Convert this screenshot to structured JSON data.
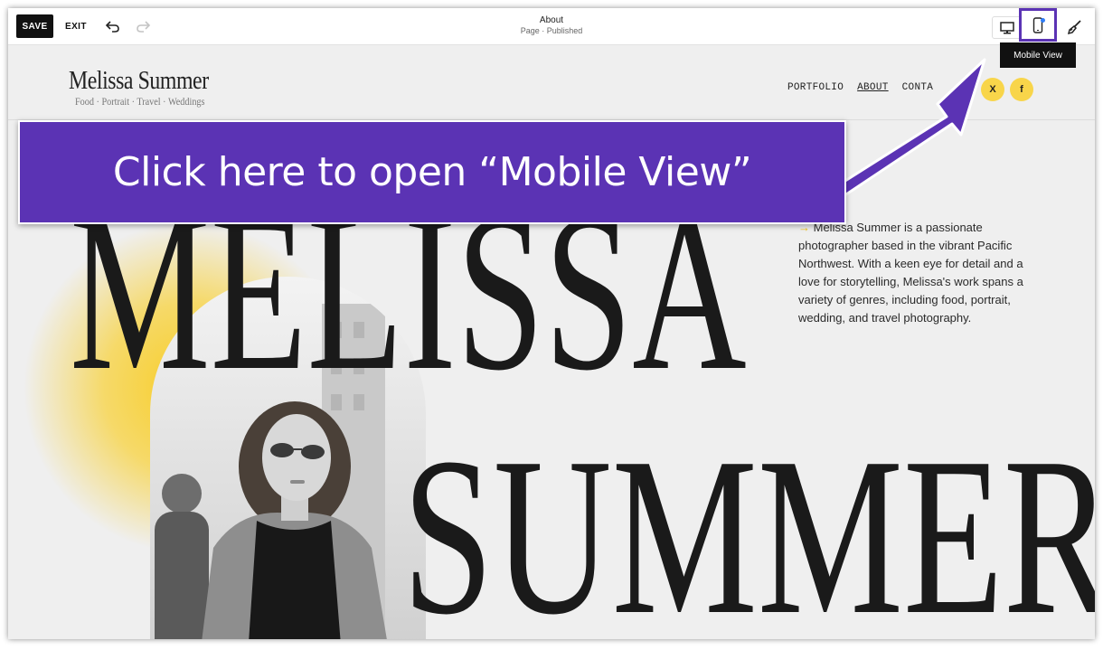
{
  "toolbar": {
    "save_label": "SAVE",
    "exit_label": "EXIT",
    "page_title": "About",
    "page_status": "Page · Published",
    "tooltip": "Mobile View"
  },
  "site": {
    "logo_name": "Melissa Summer",
    "logo_tagline": "Food · Portrait · Travel · Weddings",
    "nav": [
      "PORTFOLIO",
      "ABOUT",
      "CONTA"
    ],
    "social": [
      "X",
      "f"
    ]
  },
  "hero": {
    "word1": "MELISSA",
    "word2": "SUMMER",
    "bio_arrow": "→",
    "bio": "Melissa Summer is a passionate photographer based in the vibrant Pacific Northwest. With a keen eye for detail and a love for storytelling, Melissa's work spans a variety of genres, including food, portrait, wedding, and travel photography."
  },
  "callout": {
    "text": "Click here to open “Mobile View”"
  },
  "colors": {
    "accent": "#5b33b4",
    "yellow": "#f8d54a",
    "dot": "#2f7df6"
  },
  "icons": [
    "undo-icon",
    "redo-icon",
    "desktop-icon",
    "mobile-icon",
    "brush-icon",
    "x-icon",
    "facebook-icon"
  ]
}
